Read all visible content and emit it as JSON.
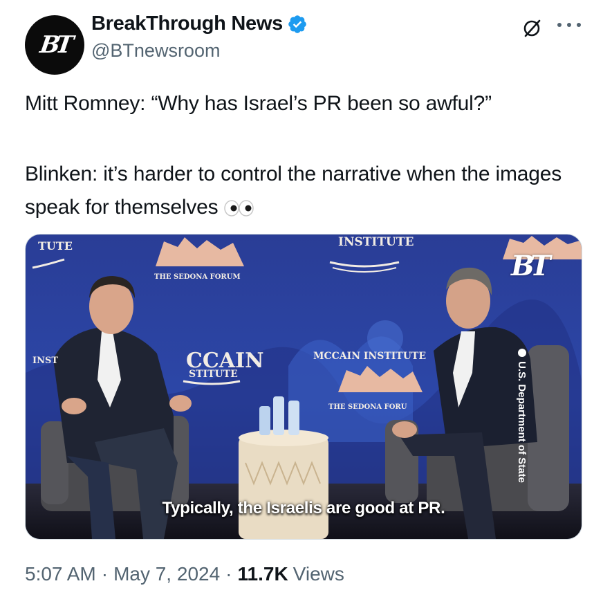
{
  "author": {
    "name": "BreakThrough News",
    "handle": "@BTnewsroom",
    "avatar_text": "BT",
    "verified": true
  },
  "tweet": {
    "line1": "Mitt Romney: “Why has Israel’s PR been so awful?”",
    "line2": "Blinken: it’s harder to control the narrative when the images speak for themselves"
  },
  "video": {
    "caption": "Typically, the Israelis are good at PR.",
    "credit": "U.S. Department of State",
    "logo": "BT",
    "backdrop_signs": {
      "sign_a": "The Sedona Forum",
      "sign_b": "Institute",
      "sign_c": "McCain Institute",
      "sign_d": "The Sedona Foru",
      "sign_e": "CCAIN",
      "sign_f": "STITUTE",
      "sign_g": "TUTE",
      "sign_h": "INST"
    }
  },
  "meta": {
    "time": "5:07 AM",
    "date": "May 7, 2024",
    "views_count": "11.7K",
    "views_label": "Views"
  },
  "colors": {
    "verified_badge": "#1d9bf0",
    "secondary_text": "#536471",
    "stage_blue": "#2b3f9c"
  },
  "icons": [
    "verified-badge-icon",
    "grok-icon",
    "more-icon",
    "eyes-emoji-icon",
    "play-credit-icon"
  ]
}
